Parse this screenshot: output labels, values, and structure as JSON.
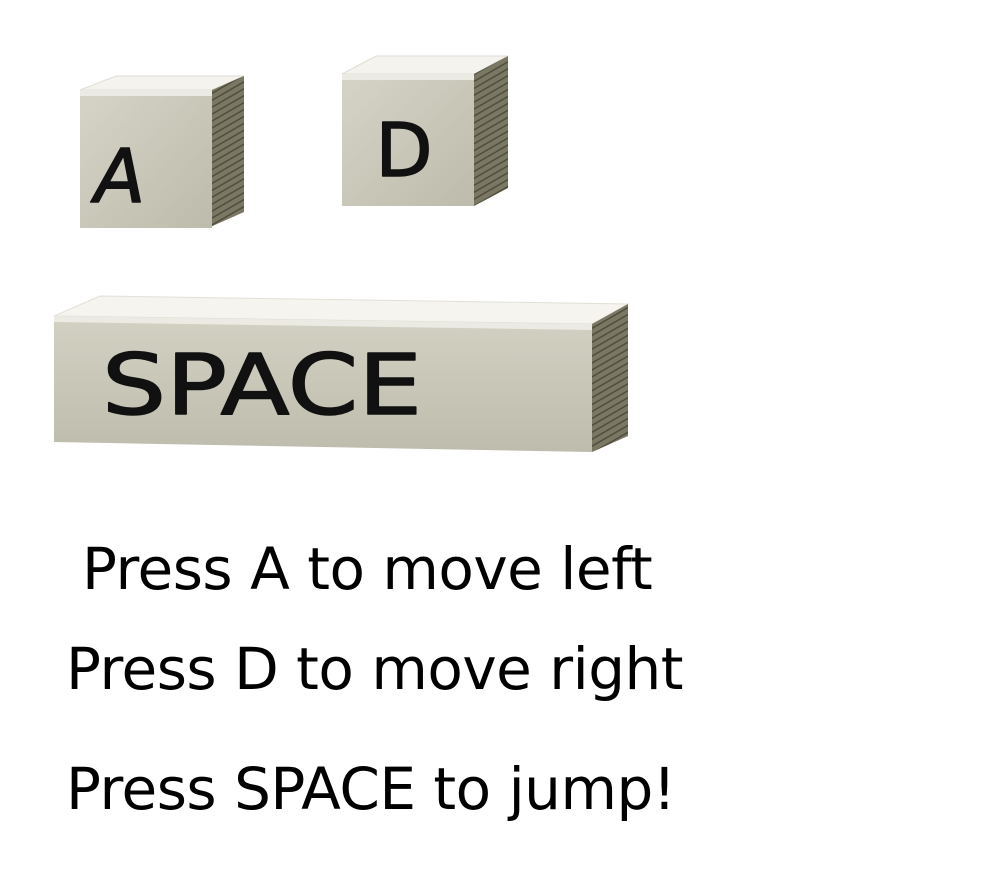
{
  "keys": {
    "a_label": "A",
    "d_label": "D",
    "space_label": "SPACE"
  },
  "instructions": {
    "move_left": "Press A to move left",
    "move_right": "Press D to move right",
    "jump": "Press SPACE to jump!"
  },
  "colors": {
    "background": "#ffffff",
    "key_face": "#c9c7b9",
    "key_top": "#f3f2ec",
    "key_side": "#6b6957",
    "text": "#000000"
  }
}
